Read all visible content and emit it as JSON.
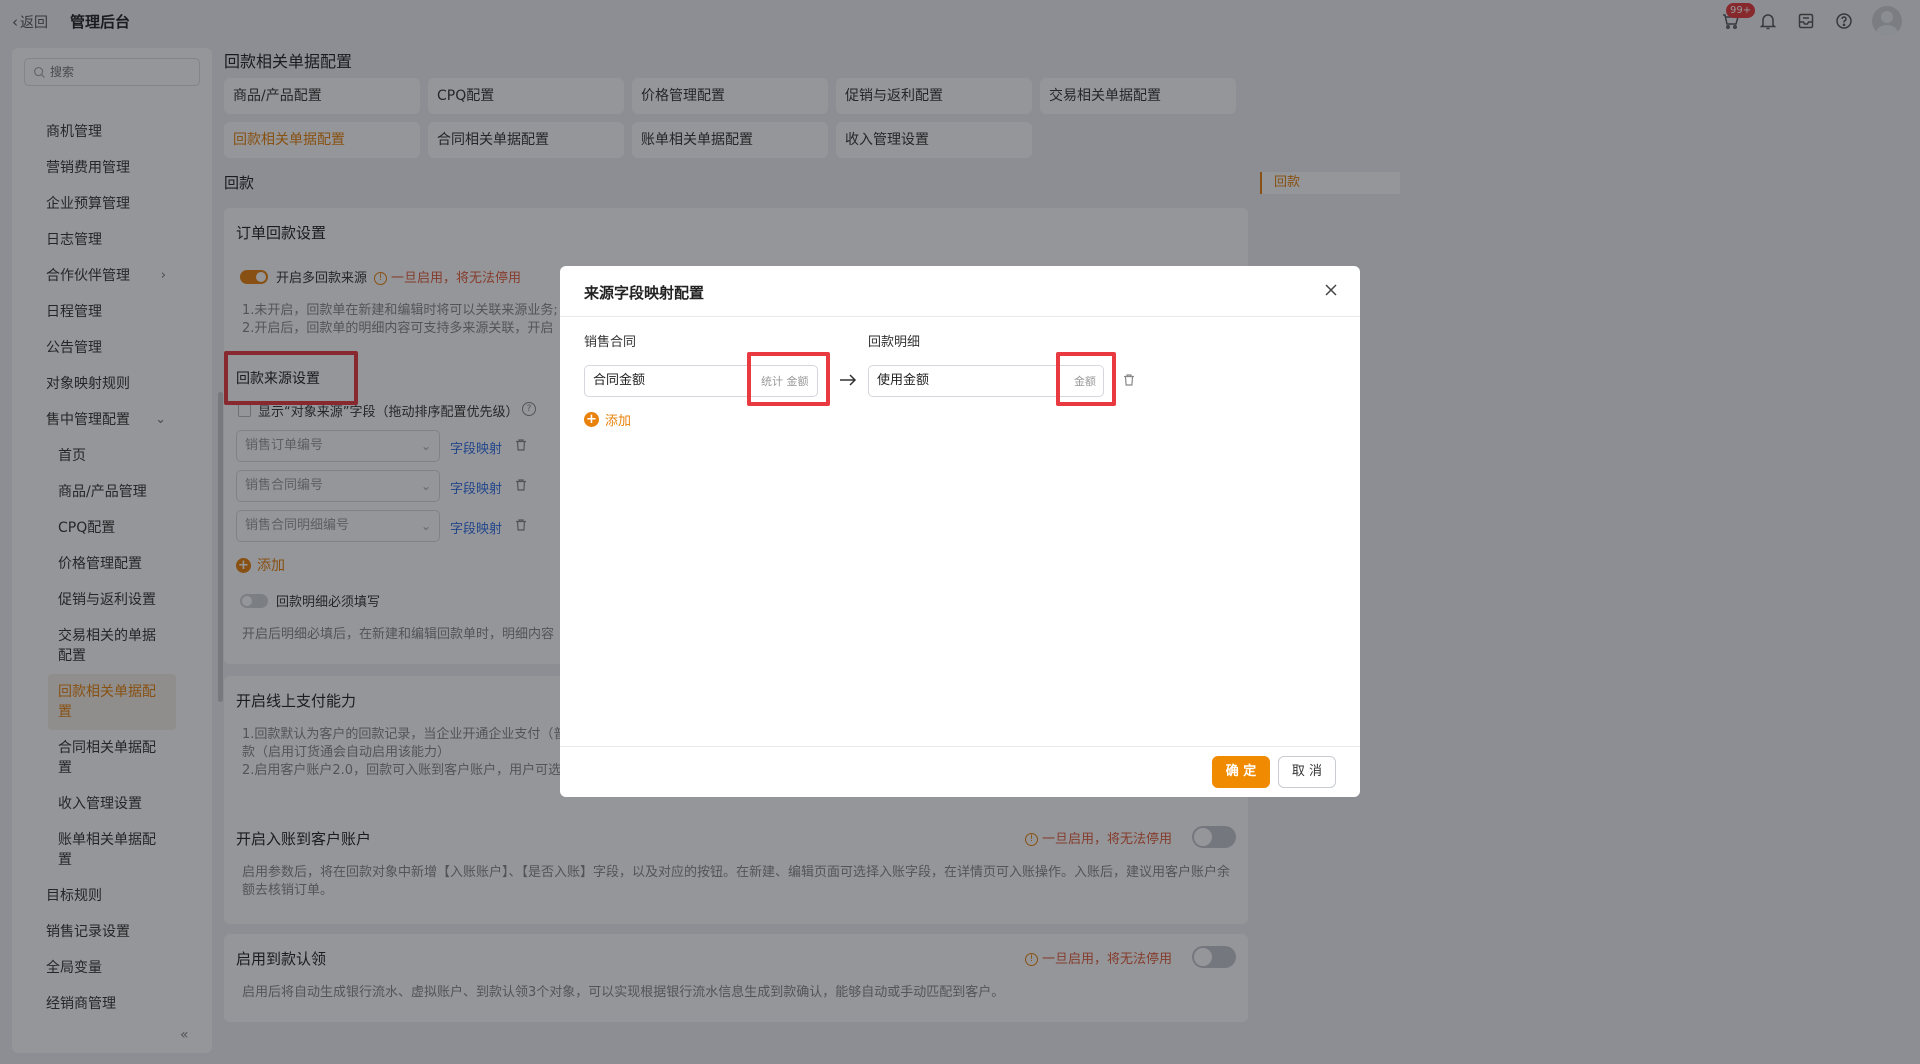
{
  "header": {
    "back_label": "返回",
    "app_title": "管理后台",
    "notification_count": "99+"
  },
  "sidebar": {
    "search_placeholder": "搜索",
    "items": [
      {
        "label": "商机管理"
      },
      {
        "label": "营销费用管理"
      },
      {
        "label": "企业预算管理"
      },
      {
        "label": "日志管理"
      },
      {
        "label": "合作伙伴管理"
      },
      {
        "label": "日程管理"
      },
      {
        "label": "公告管理"
      },
      {
        "label": "对象映射规则"
      },
      {
        "label": "售中管理配置"
      }
    ],
    "sub_items": [
      {
        "label": "首页"
      },
      {
        "label": "商品/产品管理"
      },
      {
        "label": "CPQ配置"
      },
      {
        "label": "价格管理配置"
      },
      {
        "label": "促销与返利设置"
      },
      {
        "label": "交易相关的单据配置"
      },
      {
        "label": "回款相关单据配置"
      },
      {
        "label": "合同相关单据配置"
      },
      {
        "label": "收入管理设置"
      },
      {
        "label": "账单相关单据配置"
      }
    ],
    "bottom_items": [
      {
        "label": "目标规则"
      },
      {
        "label": "销售记录设置"
      },
      {
        "label": "全局变量"
      },
      {
        "label": "经销商管理"
      }
    ],
    "collapse_label": "«"
  },
  "main": {
    "page_title": "回款相关单据配置",
    "tabs": [
      {
        "label": "商品/产品配置"
      },
      {
        "label": "CPQ配置"
      },
      {
        "label": "价格管理配置"
      },
      {
        "label": "促销与返利配置"
      },
      {
        "label": "交易相关单据配置"
      },
      {
        "label": "回款相关单据配置"
      },
      {
        "label": "合同相关单据配置"
      },
      {
        "label": "账单相关单据配置"
      },
      {
        "label": "收入管理设置"
      }
    ],
    "active_tab": 5,
    "section_label": "回款",
    "anchor_label": "回款",
    "order_card": {
      "title": "订单回款设置",
      "multi_source_label": "开启多回款来源",
      "multi_source_warning": "一旦启用，将无法停用",
      "note_1": "1.未开启，回款单在新建和编辑时将可以关联来源业务;",
      "note_2": "2.开启后，回款单的明细内容可支持多来源关联，开启",
      "source_title": "回款来源设置",
      "show_field_label": "显示“对象来源”字段（拖动排序配置优先级）",
      "sources": [
        {
          "value": "销售订单编号",
          "link": "字段映射"
        },
        {
          "value": "销售合同编号",
          "link": "字段映射"
        },
        {
          "value": "销售合同明细编号",
          "link": "字段映射"
        }
      ],
      "add_label": "添加",
      "detail_required_label": "回款明细必须填写",
      "detail_required_note": "开启后明细必填后，在新建和编辑回款单时，明细内容"
    },
    "online_pay_card": {
      "title": "开启线上支付能力",
      "note_1": "1.回款默认为客户的回款记录，当企业开通企业支付（普",
      "note_1b": "款（启用订货通会自动启用该能力）",
      "note_2": "2.启用客户账户2.0，回款可入账到客户账户，用户可选"
    },
    "account_card": {
      "title": "开启入账到客户账户",
      "warning": "一旦启用，将无法停用",
      "note": "启用参数后，将在回款对象中新增【入账账户】、【是否入账】字段，以及对应的按钮。在新建、编辑页面可选择入账字段，在详情页可入账操作。入账后，建议用客户账户余额去核销订单。"
    },
    "claim_card": {
      "title": "启用到款认领",
      "warning": "一旦启用，将无法停用",
      "note": "启用后将自动生成银行流水、虚拟账户、到款认领3个对象，可以实现根据银行流水信息生成到款确认，能够自动或手动匹配到客户。"
    }
  },
  "modal": {
    "title": "来源字段映射配置",
    "source_label": "销售合同",
    "target_label": "回款明细",
    "source_field": "合同金额",
    "source_tag": "统计 金额",
    "target_field": "使用金额",
    "target_tag": "金额",
    "add_label": "添加",
    "confirm_label": "确 定",
    "cancel_label": "取 消"
  },
  "colors": {
    "accent": "#e8820c",
    "primary_button": "#f08a00",
    "highlight_box": "#e83a40",
    "link": "#2f6ee5",
    "warning_text": "#e25c3b"
  }
}
